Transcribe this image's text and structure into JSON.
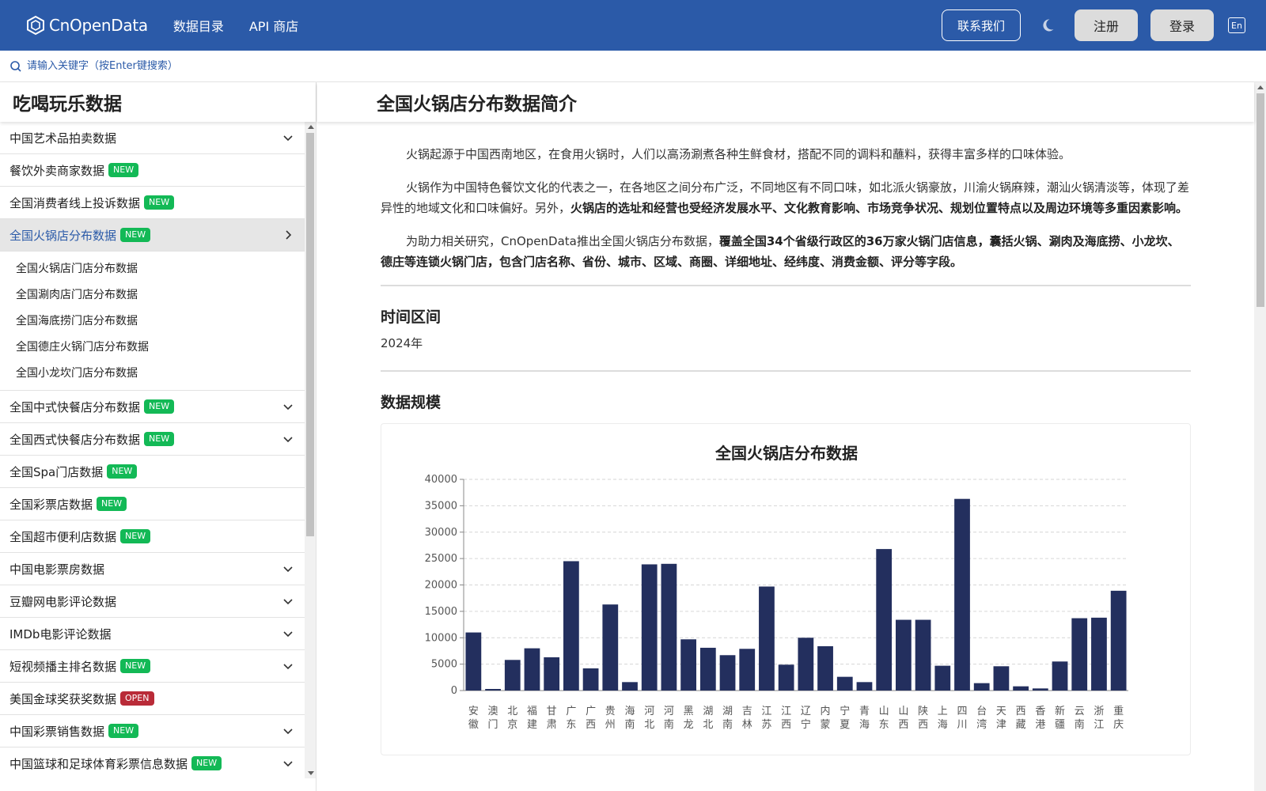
{
  "header": {
    "logo_text": "CnOpenData",
    "nav": [
      "数据目录",
      "API 商店"
    ],
    "contact": "联系我们",
    "register": "注册",
    "login": "登录",
    "lang": "En"
  },
  "search": {
    "placeholder": "请输入关键字（按Enter键搜索）"
  },
  "sidebar": {
    "title": "吃喝玩乐数据",
    "items": [
      {
        "label": "中国艺术品拍卖数据",
        "badge": "",
        "chevron": "down"
      },
      {
        "label": "餐饮外卖商家数据",
        "badge": "NEW",
        "chevron": ""
      },
      {
        "label": "全国消费者线上投诉数据",
        "badge": "NEW",
        "chevron": ""
      },
      {
        "label": "全国火锅店分布数据",
        "badge": "NEW",
        "chevron": "right",
        "active": true
      },
      {
        "label": "全国中式快餐店分布数据",
        "badge": "NEW",
        "chevron": "down"
      },
      {
        "label": "全国西式快餐店分布数据",
        "badge": "NEW",
        "chevron": "down"
      },
      {
        "label": "全国Spa门店数据",
        "badge": "NEW",
        "chevron": ""
      },
      {
        "label": "全国彩票店数据",
        "badge": "NEW",
        "chevron": ""
      },
      {
        "label": "全国超市便利店数据",
        "badge": "NEW",
        "chevron": ""
      },
      {
        "label": "中国电影票房数据",
        "badge": "",
        "chevron": "down"
      },
      {
        "label": "豆瓣网电影评论数据",
        "badge": "",
        "chevron": "down"
      },
      {
        "label": "IMDb电影评论数据",
        "badge": "",
        "chevron": "down"
      },
      {
        "label": "短视频播主排名数据",
        "badge": "NEW",
        "chevron": "down"
      },
      {
        "label": "美国金球奖获奖数据",
        "badge": "OPEN",
        "chevron": ""
      },
      {
        "label": "中国彩票销售数据",
        "badge": "NEW",
        "chevron": "down"
      },
      {
        "label": "中国篮球和足球体育彩票信息数据",
        "badge": "NEW",
        "chevron": "down"
      }
    ],
    "sub_items": [
      "全国火锅店门店分布数据",
      "全国涮肉店门店分布数据",
      "全国海底捞门店分布数据",
      "全国德庄火锅门店分布数据",
      "全国小龙坎门店分布数据"
    ]
  },
  "main": {
    "title": "全国火锅店分布数据简介",
    "para1": "火锅起源于中国西南地区，在食用火锅时，人们以高汤涮煮各种生鲜食材，搭配不同的调料和蘸料，获得丰富多样的口味体验。",
    "para2_plain": "火锅作为中国特色餐饮文化的代表之一，在各地区之间分布广泛，不同地区有不同口味，如北派火锅豪放，川渝火锅麻辣，潮汕火锅清淡等，体现了差异性的地域文化和口味偏好。另外，",
    "para2_bold": "火锅店的选址和经营也受经济发展水平、文化教育影响、市场竞争状况、规划位置特点以及周边环境等多重因素影响。",
    "para3_plain": "为助力相关研究，CnOpenData推出全国火锅店分布数据，",
    "para3_bold": "覆盖全国34个省级行政区的36万家火锅门店信息，囊括火锅、涮肉及海底捞、小龙坎、德庄等连锁火锅门店，包含门店名称、省份、城市、区域、商圈、详细地址、经纬度、消费金额、评分等字段。",
    "time_title": "时间区间",
    "time_value": "2024年",
    "scale_title": "数据规模"
  },
  "chart_data": {
    "type": "bar",
    "title": "全国火锅店分布数据",
    "categories": [
      "安徽",
      "澳门",
      "北京",
      "福建",
      "甘肃",
      "广东",
      "广西",
      "贵州",
      "海南",
      "河北",
      "河南",
      "黑龙江",
      "湖北",
      "湖南",
      "吉林",
      "江苏",
      "江西",
      "辽宁",
      "内蒙古",
      "宁夏",
      "青海",
      "山东",
      "山西",
      "陕西",
      "上海",
      "四川",
      "台湾",
      "天津",
      "西藏",
      "香港",
      "新疆",
      "云南",
      "浙江",
      "重庆"
    ],
    "values": [
      11000,
      300,
      5800,
      8000,
      6300,
      24500,
      4200,
      16300,
      1600,
      23900,
      24000,
      9700,
      8100,
      6700,
      7900,
      19700,
      4900,
      10000,
      8400,
      2600,
      1600,
      26800,
      13400,
      13400,
      4700,
      36300,
      1400,
      4600,
      800,
      400,
      5500,
      13700,
      13800,
      18900
    ],
    "ylim": [
      0,
      40000
    ],
    "yticks": [
      0,
      5000,
      10000,
      15000,
      20000,
      25000,
      30000,
      35000,
      40000
    ],
    "grid": true,
    "bar_color": "#232f5e"
  }
}
